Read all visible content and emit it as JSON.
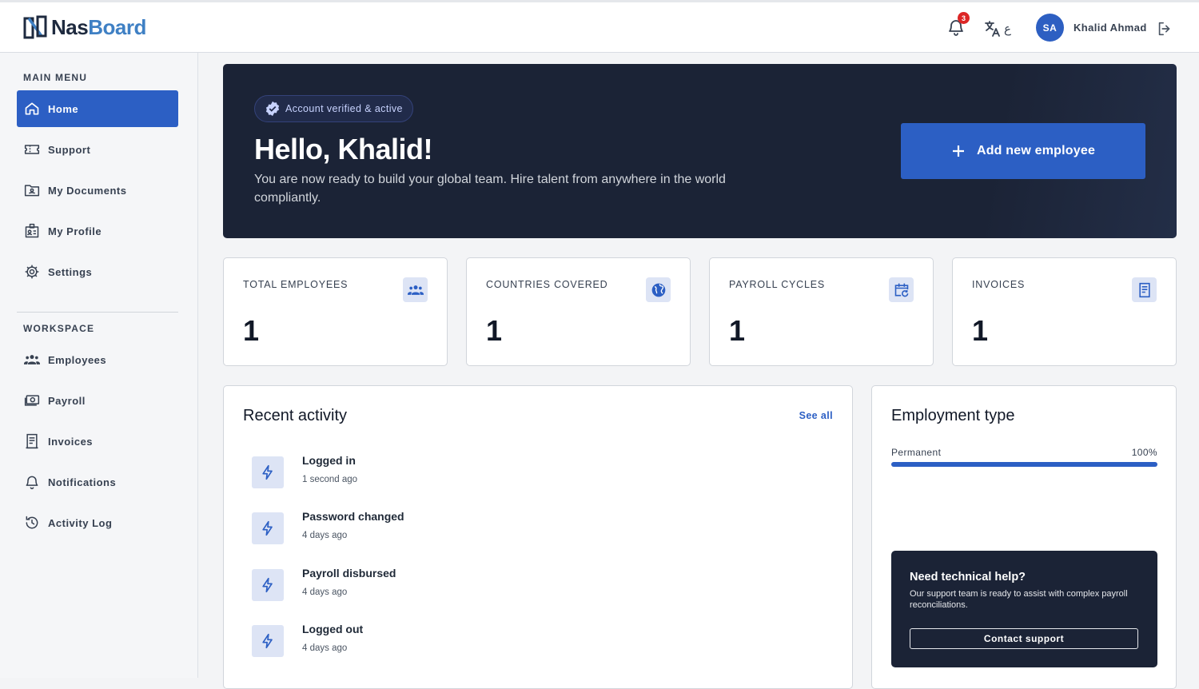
{
  "app": {
    "logo_part1": "Nas",
    "logo_part2": "Board"
  },
  "header": {
    "notification_count": "3",
    "lang_glyph": "ع",
    "avatar_initials": "SA",
    "user_name": "Khalid Ahmad"
  },
  "sidebar": {
    "main_title": "MAIN MENU",
    "main_items": [
      {
        "label": "Home",
        "icon": "home-icon",
        "active": true
      },
      {
        "label": "Support",
        "icon": "ticket-icon"
      },
      {
        "label": "My Documents",
        "icon": "documents-icon"
      },
      {
        "label": "My Profile",
        "icon": "profile-icon"
      },
      {
        "label": "Settings",
        "icon": "gear-icon"
      }
    ],
    "workspace_title": "WORKSPACE",
    "workspace_items": [
      {
        "label": "Employees",
        "icon": "people-icon"
      },
      {
        "label": "Payroll",
        "icon": "money-icon"
      },
      {
        "label": "Invoices",
        "icon": "invoice-icon"
      },
      {
        "label": "Notifications",
        "icon": "bell-icon"
      },
      {
        "label": "Activity Log",
        "icon": "history-icon"
      }
    ]
  },
  "hero": {
    "badge": "Account verified & active",
    "greeting": "Hello, Khalid!",
    "subtitle": "You are now ready to build your global team. Hire talent from anywhere in the world compliantly.",
    "add_button": "Add new employee"
  },
  "stats": [
    {
      "label": "TOTAL EMPLOYEES",
      "value": "1",
      "icon": "people-icon"
    },
    {
      "label": "COUNTRIES COVERED",
      "value": "1",
      "icon": "globe-icon"
    },
    {
      "label": "PAYROLL CYCLES",
      "value": "1",
      "icon": "calendar-refresh-icon"
    },
    {
      "label": "INVOICES",
      "value": "1",
      "icon": "receipt-icon"
    }
  ],
  "activity": {
    "title": "Recent activity",
    "see_all": "See all",
    "items": [
      {
        "title": "Logged in",
        "time": "1 second ago"
      },
      {
        "title": "Password changed",
        "time": "4 days ago"
      },
      {
        "title": "Payroll disbursed",
        "time": "4 days ago"
      },
      {
        "title": "Logged out",
        "time": "4 days ago"
      }
    ]
  },
  "employment": {
    "title": "Employment type",
    "rows": [
      {
        "label": "Permanent",
        "percent_text": "100%",
        "fraction": 1.0
      }
    ],
    "help_title": "Need technical help?",
    "help_text": "Our support team is ready to assist with complex payroll reconciliations.",
    "help_button": "Contact support"
  },
  "colors": {
    "accent": "#2c5fc4",
    "hero_bg": "#1b2336",
    "badge_red": "#dc2626"
  }
}
